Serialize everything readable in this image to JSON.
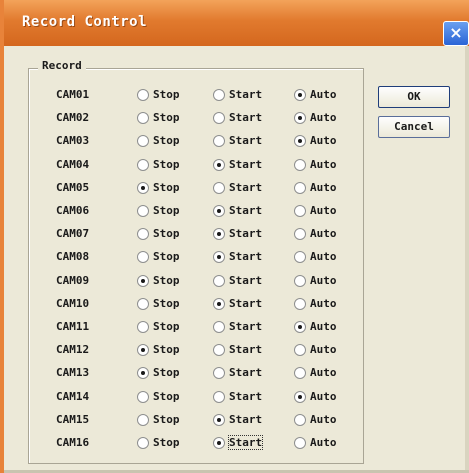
{
  "window": {
    "title": "Record Control",
    "close_glyph": "×",
    "accent": "#e17a2e"
  },
  "group": {
    "label": "Record"
  },
  "options": {
    "stop": "Stop",
    "start": "Start",
    "auto": "Auto"
  },
  "buttons": {
    "ok": "OK",
    "cancel": "Cancel"
  },
  "cameras": [
    {
      "name": "CAM01",
      "selected": "auto"
    },
    {
      "name": "CAM02",
      "selected": "auto"
    },
    {
      "name": "CAM03",
      "selected": "auto"
    },
    {
      "name": "CAM04",
      "selected": "start"
    },
    {
      "name": "CAM05",
      "selected": "stop"
    },
    {
      "name": "CAM06",
      "selected": "start"
    },
    {
      "name": "CAM07",
      "selected": "start"
    },
    {
      "name": "CAM08",
      "selected": "start"
    },
    {
      "name": "CAM09",
      "selected": "stop"
    },
    {
      "name": "CAM10",
      "selected": "start"
    },
    {
      "name": "CAM11",
      "selected": "auto"
    },
    {
      "name": "CAM12",
      "selected": "stop"
    },
    {
      "name": "CAM13",
      "selected": "stop"
    },
    {
      "name": "CAM14",
      "selected": "auto"
    },
    {
      "name": "CAM15",
      "selected": "start"
    },
    {
      "name": "CAM16",
      "selected": "start",
      "focused": true
    }
  ]
}
